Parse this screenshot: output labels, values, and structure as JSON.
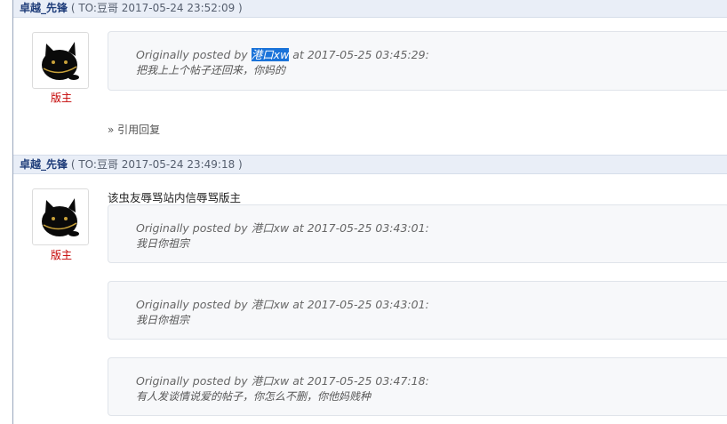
{
  "posts": [
    {
      "author": "卓越_先锋",
      "meta": "( TO:豆哥   2017-05-24 23:52:09 )",
      "role": "版主",
      "quotes": [
        {
          "prefix": "Originally posted by",
          "user": "港口xw",
          "suffix": "at 2017-05-25 03:45:29:",
          "text": "把我上上个帖子还回来，你妈的"
        }
      ],
      "reply_link": "» 引用回复"
    },
    {
      "author": "卓越_先锋",
      "meta": "( TO:豆哥   2017-05-24 23:49:18 )",
      "role": "版主",
      "body": "该虫友辱骂站内信辱骂版主",
      "quotes": [
        {
          "head": "Originally posted by 港口xw at 2017-05-25 03:43:01:",
          "text": "我日你祖宗"
        },
        {
          "head": "Originally posted by 港口xw at 2017-05-25 03:43:01:",
          "text": "我日你祖宗"
        },
        {
          "head": "Originally posted by 港口xw at 2017-05-25 03:47:18:",
          "text": "有人发谈情说爱的帖子，你怎么不删，你他妈贱种"
        }
      ]
    }
  ],
  "avatar_icon": "black-cat-avatar-icon",
  "colors": {
    "header_bg": "#e9eef7",
    "author": "#1f3d7a",
    "role": "#c40000",
    "selection": "#1a73d9",
    "quote_bg": "#f7f8fa"
  }
}
